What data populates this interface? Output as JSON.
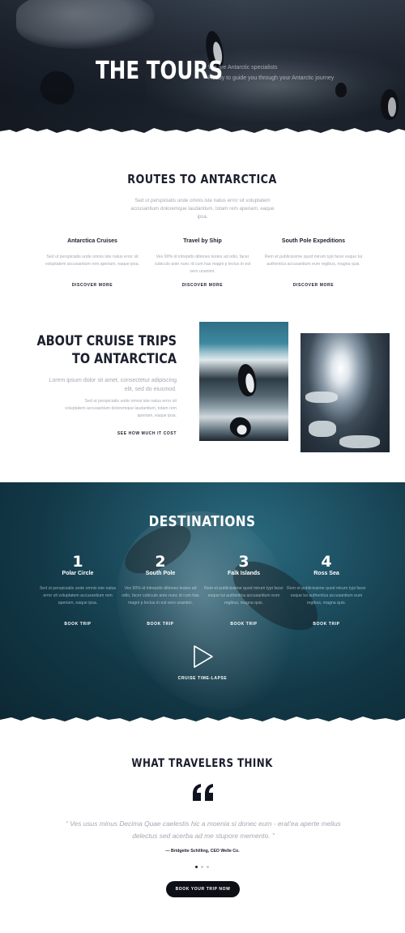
{
  "hero": {
    "title": "THE TOURS",
    "subtitle_line1": "We are Antarctic specialists",
    "subtitle_line2": "Ready to guide you through your Antarctic journey"
  },
  "routes": {
    "title": "ROUTES TO ANTARCTICA",
    "intro": "Sed ut perspiciatis unde omnis iste natus error sit voluptatem accusantium doloremque laudantium, totam rem aperiam, eaque ipsa.",
    "columns": [
      {
        "title": "Antarctica Cruises",
        "text": "Sed ut perspiciatis unde omnis iste natus error sit voluptatem accusantium rem aperiam, eaque ipsa.",
        "link": "DISCOVER MORE"
      },
      {
        "title": "Travel by Ship",
        "text": "Ves 90% id intrepido ditiones testes ad odio, facer cubiculo ante nunc id cum has magni p lectus in est vero unanimi.",
        "link": "DISCOVER MORE"
      },
      {
        "title": "South Pole Expeditions",
        "text": "Rem et publicissime quod mirum typi facer esque tui authentica accusantium eum regibus, magna quis.",
        "link": "DISCOVER MORE"
      }
    ]
  },
  "about": {
    "title_line1": "ABOUT CRUISE TRIPS",
    "title_line2": "TO ANTARCTICA",
    "lead": "Lorem ipsum dolor sit amet, consectetur adipiscing elit, sed do eiusmod.",
    "text": "Sed ut perspiciatis unde omnis iste natus error sit voluptatem accusantium doloremque laudantium, totam rem aperiam, eaque ipsa.",
    "link": "SEE HOW MUCH IT COST"
  },
  "destinations": {
    "title": "DESTINATIONS",
    "items": [
      {
        "num": "1",
        "name": "Polar Circle",
        "text": "Sed ut perspiciatis unde omnis iste natus error sit voluptatem accusantium rem aperiam, eaque ipsa.",
        "link": "BOOK TRIP"
      },
      {
        "num": "2",
        "name": "South Pole",
        "text": "Vez 90% id intrepido ditiones testes ad odio, facer cubiculo ante nunc id cum has magni p lectus in est vero unanimi.",
        "link": "BOOK TRIP"
      },
      {
        "num": "3",
        "name": "Falk Islands",
        "text": "Rem et publicissime quod mirum typi facer esque tui authentica accusantium eum regibus, magna quis.",
        "link": "BOOK TRIP"
      },
      {
        "num": "4",
        "name": "Ross Sea",
        "text": "Rem et publicissime quod mirum typi facer esque tui authentica accusantium eum regibus, magna quis.",
        "link": "BOOK TRIP"
      }
    ],
    "video_label": "CRUISE TIME-LAPSE"
  },
  "testimonials": {
    "title": "WHAT TRAVELERS THINK",
    "quote": "“ Ves usus minus Decima Quae caelestis hic a moenia si donec eum - erat'ea aperte melius delectus sed acerba ad me stupore memento. ”",
    "author": "— Bridgette Schilling, CEO Welle Co.",
    "cta": "BOOK YOUR TRIP NOW"
  },
  "icons": {
    "play": "play-icon",
    "quote": "quote-icon"
  },
  "colors": {
    "text_dark": "#1b1f2e",
    "text_muted": "#a4a8b1",
    "destinations_bg": "#123846",
    "cta_bg": "#0c0f16"
  }
}
